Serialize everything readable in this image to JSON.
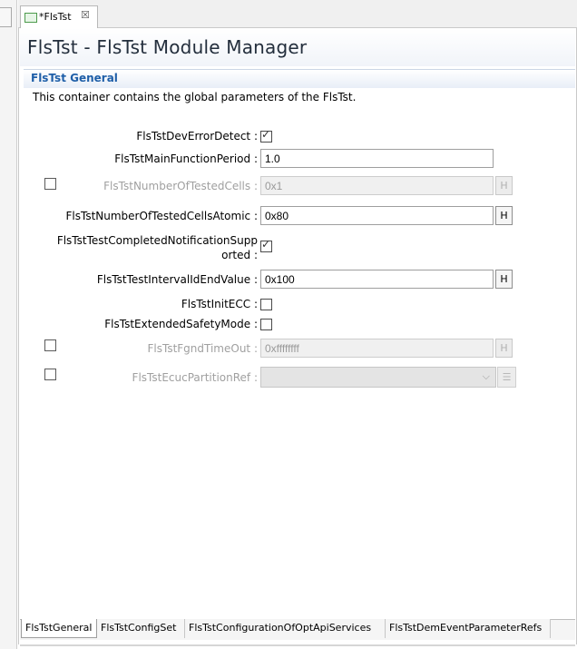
{
  "editor_tab": {
    "label": "*FlsTst",
    "close_glyph": "☒"
  },
  "page": {
    "title": "FlsTst - FlsTst Module Manager"
  },
  "section": {
    "title": "FlsTst General",
    "description": "This container contains the global parameters of the FlsTst."
  },
  "fields": {
    "dev_error_detect": {
      "label": "FlsTstDevErrorDetect :",
      "checked": true
    },
    "main_function_period": {
      "label": "FlsTstMainFunctionPeriod :",
      "value": "1.0"
    },
    "number_of_tested_cells": {
      "label": "FlsTstNumberOfTestedCells :",
      "value": "0x1",
      "enabled": false
    },
    "number_of_tested_cells_atomic": {
      "label": "FlsTstNumberOfTestedCellsAtomic :",
      "value": "0x80"
    },
    "test_completed_notification": {
      "label_line1": "FlsTstTestCompletedNotificationSupp",
      "label_line2": "orted :",
      "checked": true
    },
    "test_interval_id_end_value": {
      "label": "FlsTstTestIntervalIdEndValue :",
      "value": "0x100"
    },
    "init_ecc": {
      "label": "FlsTstInitECC :",
      "checked": false
    },
    "extended_safety_mode": {
      "label": "FlsTstExtendedSafetyMode :",
      "checked": false
    },
    "fgnd_timeout": {
      "label": "FlsTstFgndTimeOut :",
      "value": "0xffffffff",
      "enabled": false
    },
    "ecuc_partition_ref": {
      "label": "FlsTstEcucPartitionRef :",
      "value": "",
      "enabled": false
    }
  },
  "buttons": {
    "hex_label": "H"
  },
  "icons": {
    "combo_arrow": "chevron-down-icon",
    "list_button": "list-icon",
    "tab_icon": "editor-tab-icon"
  },
  "bottom_tabs": [
    {
      "label": "FlsTstGeneral",
      "active": true
    },
    {
      "label": "FlsTstConfigSet"
    },
    {
      "label": "FlsTstConfigurationOfOptApiServices"
    },
    {
      "label": "FlsTstDemEventParameterRefs"
    }
  ]
}
